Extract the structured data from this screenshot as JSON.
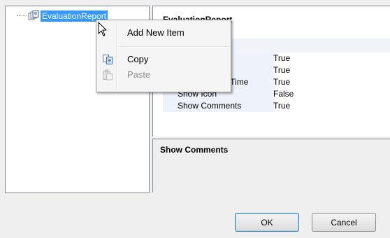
{
  "tree": {
    "node_label": "EvaluationReport"
  },
  "property_panel": {
    "title": "EvaluationReport",
    "rows": [
      {
        "name": "",
        "value": "True"
      },
      {
        "name": "",
        "value": "True"
      },
      {
        "name": "Show Update Time",
        "value": "True"
      },
      {
        "name": "Show Icon",
        "value": "False"
      },
      {
        "name": "Show Comments",
        "value": "True"
      }
    ]
  },
  "description": {
    "title": "Show Comments"
  },
  "context_menu": {
    "add_label": "Add New Item",
    "copy_label": "Copy",
    "paste_label": "Paste",
    "copy_icon": "copy-icon",
    "paste_icon": "paste-icon"
  },
  "buttons": {
    "ok_label": "OK",
    "cancel_label": "Cancel"
  },
  "colors": {
    "selection": "#3399ff",
    "property_name_bg": "#eef2fa",
    "disabled_text": "#8f8f8f"
  }
}
